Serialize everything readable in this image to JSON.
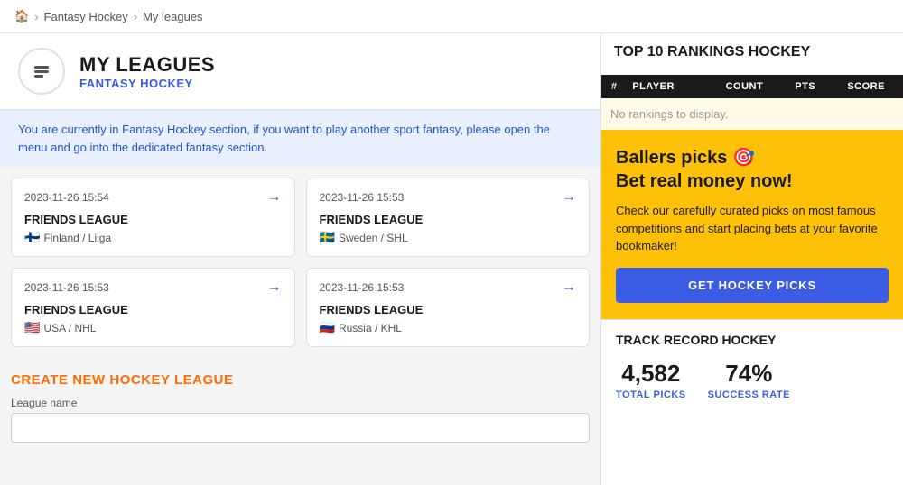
{
  "nav": {
    "home_icon": "🏠",
    "breadcrumbs": [
      "Fantasy Hockey",
      "My leagues"
    ]
  },
  "header": {
    "icon": "⬆",
    "title": "MY LEAGUES",
    "subtitle": "FANTASY HOCKEY"
  },
  "info_banner": "You are currently in Fantasy Hockey section, if you want to play another sport fantasy, please open the menu and go into the dedicated fantasy section.",
  "leagues": [
    {
      "date": "2023-11-26 15:54",
      "name": "FRIENDS LEAGUE",
      "flag": "🇫🇮",
      "country": "Finland / Liiga"
    },
    {
      "date": "2023-11-26 15:53",
      "name": "FRIENDS LEAGUE",
      "flag": "🇸🇪",
      "country": "Sweden / SHL"
    },
    {
      "date": "2023-11-26 15:53",
      "name": "FRIENDS LEAGUE",
      "flag": "🇺🇸",
      "country": "USA / NHL"
    },
    {
      "date": "2023-11-26 15:53",
      "name": "FRIENDS LEAGUE",
      "flag": "🇷🇺",
      "country": "Russia / KHL"
    }
  ],
  "create_section": {
    "title": "CREATE NEW HOCKEY LEAGUE",
    "label": "League name",
    "placeholder": ""
  },
  "rankings": {
    "title": "TOP 10 RANKINGS HOCKEY",
    "columns": [
      "#",
      "PLAYER",
      "COUNT",
      "PTS",
      "SCORE"
    ],
    "empty_message": "No rankings to display."
  },
  "promo": {
    "title_line1": "Ballers picks 🎯",
    "title_line2": "Bet real money now!",
    "description": "Check our carefully curated picks on most famous competitions and start placing bets at your favorite bookmaker!",
    "button_label": "GET HOCKEY PICKS"
  },
  "track_record": {
    "title": "TRACK RECORD HOCKEY",
    "total_picks_value": "4,582",
    "total_picks_label": "TOTAL PICKS",
    "success_rate_value": "74%",
    "success_rate_label": "SUCCESS RATE"
  }
}
